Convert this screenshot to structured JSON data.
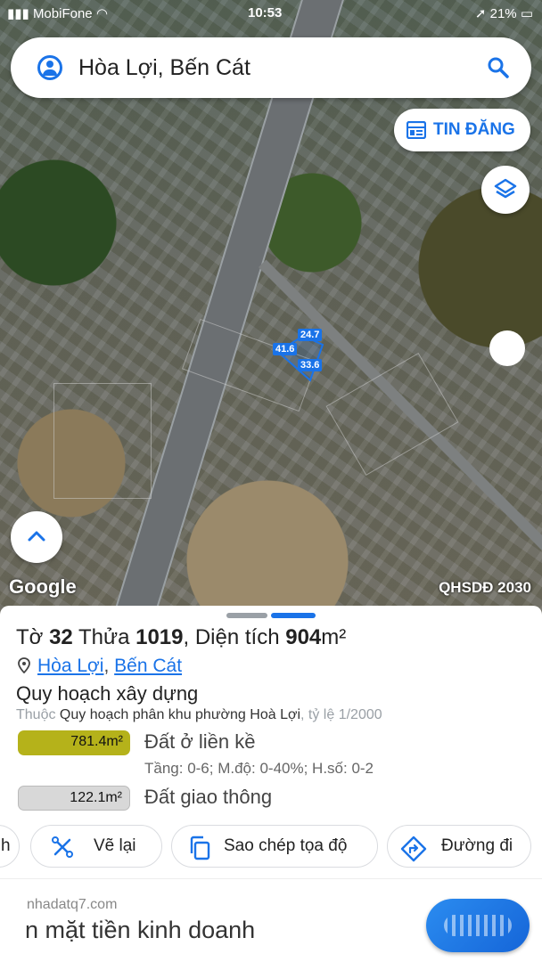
{
  "status_bar": {
    "carrier": "MobiFone",
    "time": "10:53",
    "battery": "21%"
  },
  "search": {
    "query": "Hòa Lợi, Bến Cát"
  },
  "map": {
    "tin_dang_label": "TIN ĐĂNG",
    "dimensions": [
      "24.7",
      "41.6",
      "33.6"
    ],
    "google_logo": "Google",
    "plan_label": "QHSDĐ 2030"
  },
  "parcel": {
    "to_label": "Tờ",
    "to_value": "32",
    "thua_label": "Thửa",
    "thua_value": "1019",
    "dien_tich_label": "Diện tích",
    "dien_tich_value": "904",
    "unit": "m²",
    "ward": "Hòa Lợi",
    "district": "Bến Cát",
    "section_title": "Quy hoạch xây dựng",
    "thuoc_prefix": "Thuộc",
    "plan_name": "Quy hoạch phân khu phường Hoà Lợi",
    "scale": ", tỷ lệ 1/2000",
    "zones": [
      {
        "area": "781.4m²",
        "label": "Đất ở liền kề",
        "color": "#b5b21a",
        "detail": "Tầng: 0-6; M.độ: 0-40%; H.số: 0-2"
      },
      {
        "area": "122.1m²",
        "label": "Đất giao thông",
        "color": "#d8d8d8"
      }
    ]
  },
  "actions": {
    "partial": "h",
    "redraw": "Vẽ lại",
    "copy_coords": "Sao chép tọa độ",
    "directions": "Đường đi"
  },
  "ad": {
    "site": "nhadatq7.com",
    "text": "n mặt tiền kinh doanh"
  },
  "colors": {
    "accent": "#1a73e8"
  }
}
